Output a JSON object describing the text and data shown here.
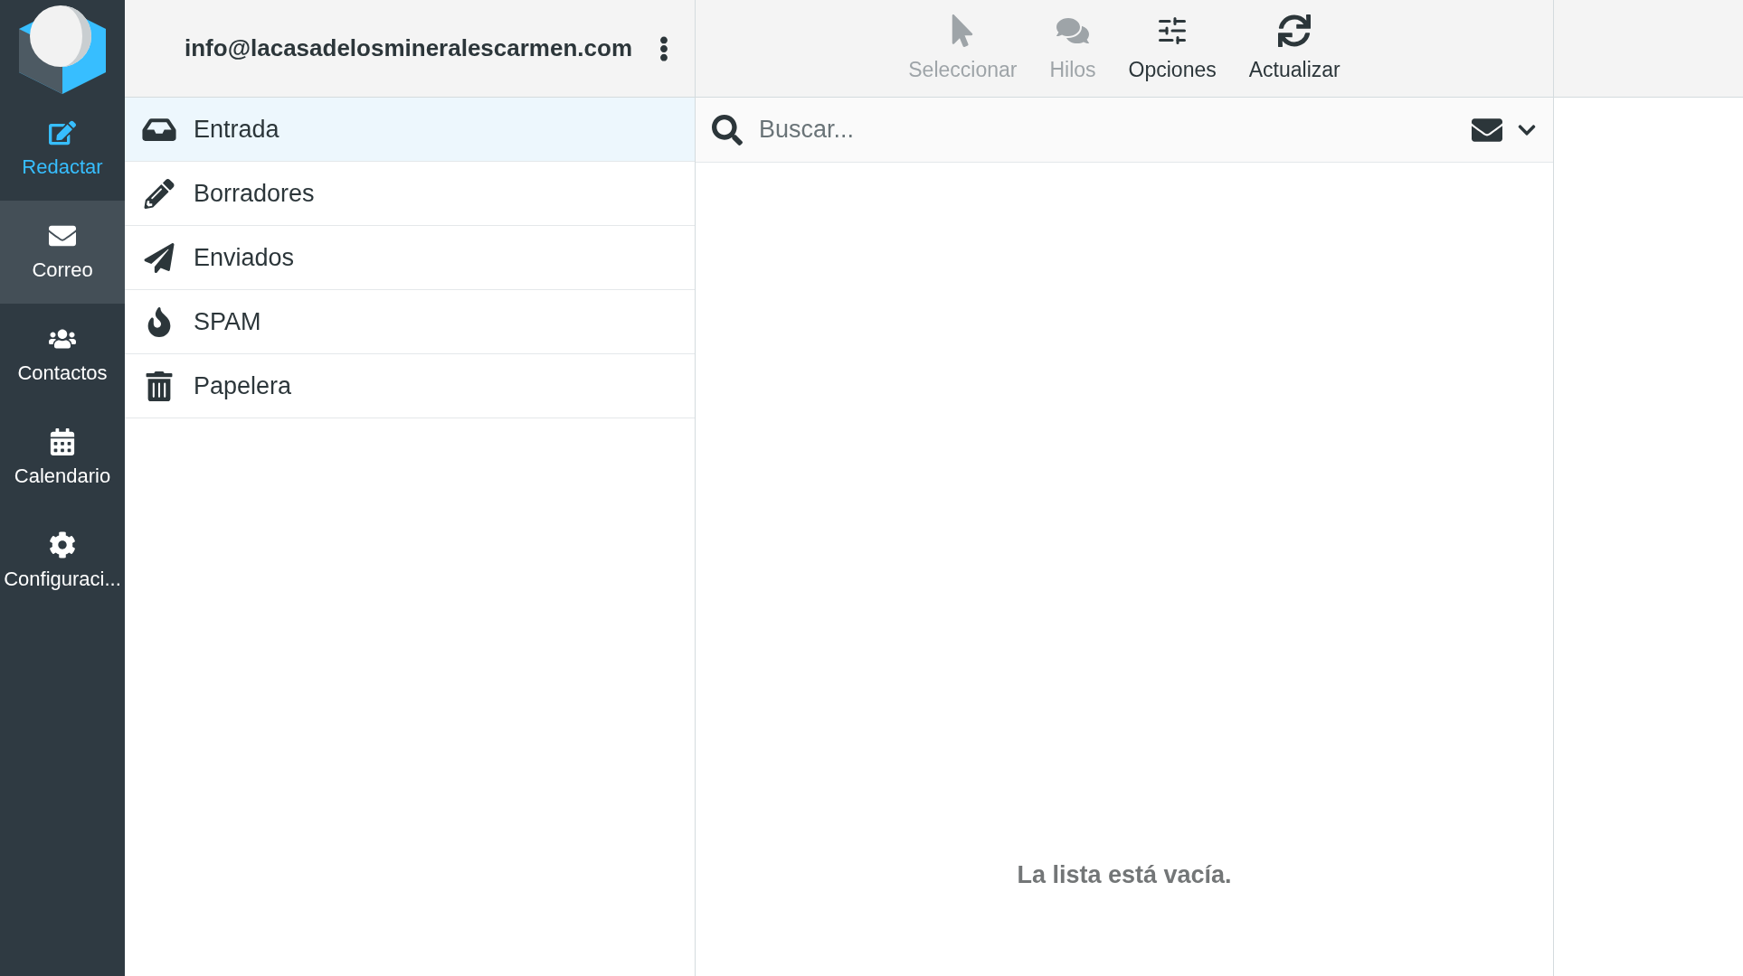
{
  "nav": [
    {
      "label": "Redactar",
      "kind": "compose",
      "selected": false
    },
    {
      "label": "Correo",
      "kind": "mail",
      "selected": true
    },
    {
      "label": "Contactos",
      "kind": "contacts",
      "selected": false
    },
    {
      "label": "Calendario",
      "kind": "calendar",
      "selected": false
    },
    {
      "label": "Configuraci...",
      "kind": "settings",
      "selected": false
    }
  ],
  "account": {
    "email": "info@lacasadelosmineralescarmen.com"
  },
  "folders": [
    {
      "name": "Entrada",
      "kind": "inbox",
      "selected": true
    },
    {
      "name": "Borradores",
      "kind": "drafts",
      "selected": false
    },
    {
      "name": "Enviados",
      "kind": "sent",
      "selected": false
    },
    {
      "name": "SPAM",
      "kind": "spam",
      "selected": false
    },
    {
      "name": "Papelera",
      "kind": "trash",
      "selected": false
    }
  ],
  "toolbar": [
    {
      "label": "Seleccionar",
      "kind": "select",
      "disabled": true
    },
    {
      "label": "Hilos",
      "kind": "threads",
      "disabled": true
    },
    {
      "label": "Opciones",
      "kind": "options",
      "disabled": false
    },
    {
      "label": "Actualizar",
      "kind": "refresh",
      "disabled": false
    }
  ],
  "search": {
    "placeholder": "Buscar..."
  },
  "message_list": {
    "empty_text": "La lista está vacía."
  }
}
